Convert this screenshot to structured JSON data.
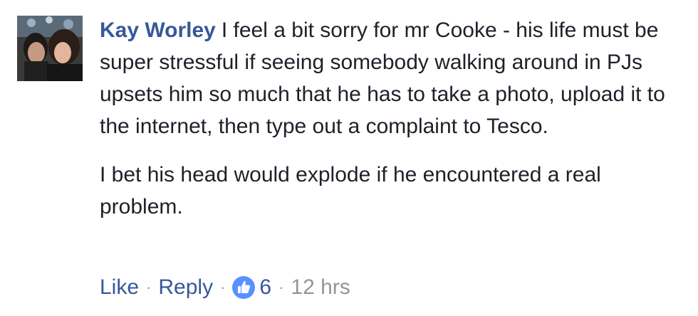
{
  "comment": {
    "author": "Kay Worley",
    "paragraphs": [
      "I feel a bit sorry for mr Cooke - his life must be super stressful if seeing somebody walking around in PJs upsets him so much that he has to take a photo, upload it to the internet, then type out a complaint to Tesco.",
      "I bet his head would explode if he encountered a real problem."
    ],
    "actions": {
      "like_label": "Like",
      "reply_label": "Reply",
      "separator": "·",
      "reaction_count": "6",
      "timestamp": "12 hrs"
    }
  },
  "icons": {
    "avatar": "profile-photo",
    "reaction": "thumbs-up-icon"
  },
  "colors": {
    "author": "#365899",
    "text": "#1d2129",
    "meta": "#90949c",
    "like_badge": "#5890ff"
  }
}
